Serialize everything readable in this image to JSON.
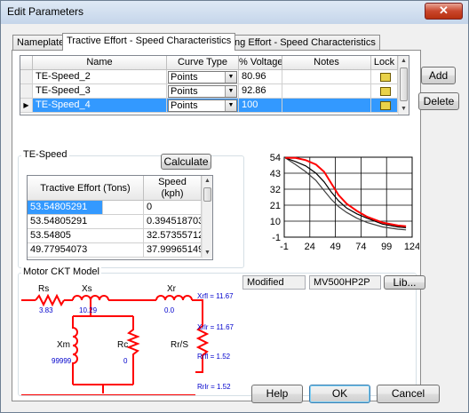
{
  "window": {
    "title": "Edit Parameters",
    "close_glyph": "✕"
  },
  "tabs": [
    "Nameplate",
    "Tractive Effort - Speed Characteristics",
    "Braking Effort - Speed Characteristics"
  ],
  "curves_table": {
    "columns": [
      "Name",
      "Curve Type",
      "% Voltage",
      "Notes",
      "Lock"
    ],
    "rows": [
      {
        "name": "TE-Speed_2",
        "curve_type": "Points",
        "voltage": "80.96",
        "notes": ""
      },
      {
        "name": "TE-Speed_3",
        "curve_type": "Points",
        "voltage": "92.86",
        "notes": ""
      },
      {
        "name": "TE-Speed_4",
        "curve_type": "Points",
        "voltage": "100",
        "notes": ""
      }
    ],
    "selected_row": 2
  },
  "side_buttons": {
    "add": "Add",
    "delete": "Delete"
  },
  "te_speed": {
    "group_label": "TE-Speed",
    "calculate": "Calculate",
    "columns": [
      "Tractive Effort (Tons)",
      "Speed\n(kph)"
    ],
    "rows": [
      [
        "53.54805291",
        "0"
      ],
      [
        "53.54805291",
        "0.394518703"
      ],
      [
        "53.54805",
        "32.57355712"
      ],
      [
        "49.77954073",
        "37.99965149"
      ]
    ]
  },
  "chart_data": {
    "type": "line",
    "x_ticks": [
      "-1",
      "24",
      "49",
      "74",
      "99",
      "124"
    ],
    "y_ticks": [
      "54",
      "43",
      "32",
      "21",
      "10",
      "-1"
    ],
    "xlim": [
      -1,
      124
    ],
    "ylim": [
      -1,
      54
    ],
    "grid": true,
    "series": [
      {
        "color": "#ff0000",
        "x": [
          0,
          10,
          20,
          30,
          38,
          45,
          52,
          60,
          70,
          80,
          95,
          110,
          118
        ],
        "y": [
          53.5,
          53.5,
          52,
          49,
          44,
          36,
          28,
          22,
          17,
          13,
          9,
          7,
          6.5
        ]
      },
      {
        "color": "#000000",
        "x": [
          0,
          10,
          20,
          30,
          38,
          45,
          52,
          60,
          70,
          80,
          95,
          110,
          118
        ],
        "y": [
          53.5,
          51,
          48,
          43,
          37,
          30,
          24,
          19,
          15,
          12,
          8,
          6,
          5.5
        ]
      },
      {
        "color": "#404040",
        "x": [
          0,
          10,
          20,
          30,
          38,
          45,
          52,
          60,
          70,
          80,
          95,
          110,
          118
        ],
        "y": [
          53.5,
          49,
          44,
          38,
          31,
          25,
          20,
          16,
          12,
          9,
          6,
          4.5,
          4
        ]
      }
    ]
  },
  "motor": {
    "group_label": "Motor CKT Model",
    "status": "Modified",
    "library_id": "MV500HP2P",
    "lib_button": "Lib...",
    "labels": {
      "rs": "Rs",
      "xs": "Xs",
      "xr": "Xr",
      "xm": "Xm",
      "rc": "Rc",
      "rr_s": "Rr/S"
    },
    "values": {
      "rs": "3.83",
      "xs": "10.29",
      "xr": "0.0",
      "xm": "99999",
      "rc": "0"
    },
    "annotations": [
      "Xrfl = 11.67",
      "Xrlr = 11.67",
      "Rrfl = 1.52",
      "Rrlr = 1.52"
    ]
  },
  "footer": {
    "help": "Help",
    "ok": "OK",
    "cancel": "Cancel"
  },
  "colors": {
    "accent": "#3399ff",
    "circuit": "#ff0000",
    "circuit_values": "#0000cc"
  }
}
